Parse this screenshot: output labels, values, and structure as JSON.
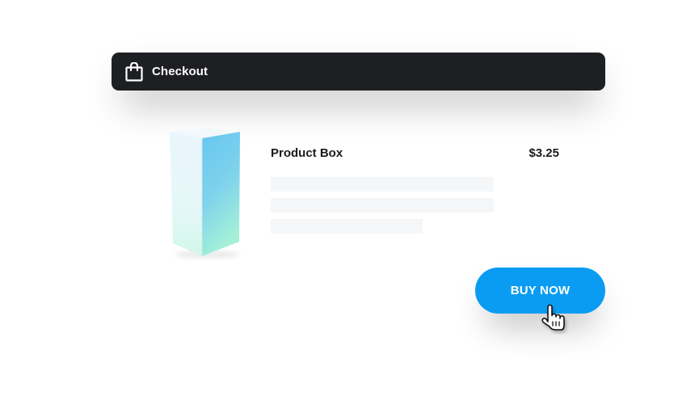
{
  "header": {
    "icon": "shopping-bag-icon",
    "title": "Checkout",
    "background": "#1e1f23"
  },
  "product": {
    "image": "product-box-image",
    "name": "Product Box",
    "price": "$3.25"
  },
  "buy_button": {
    "label": "BUY NOW",
    "color": "#0a9cf3"
  },
  "cursor": {
    "icon": "hand-pointer-icon"
  }
}
